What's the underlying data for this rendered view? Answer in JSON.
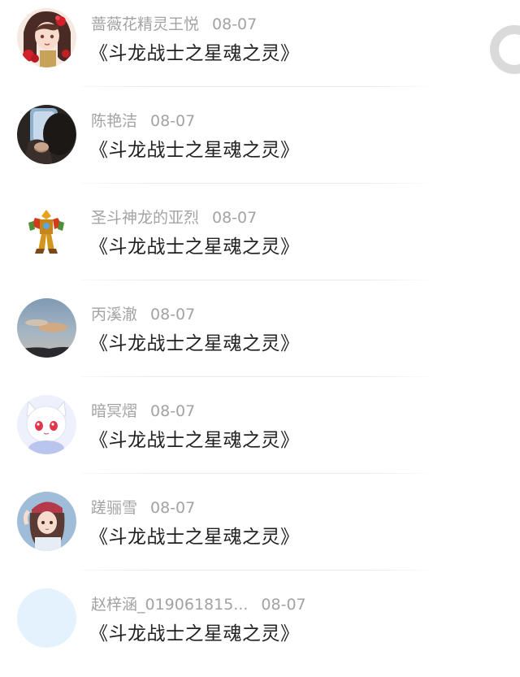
{
  "comments": [
    {
      "name": "蔷薇花精灵王悦",
      "date": "08-07",
      "text": "《斗龙战士之星魂之灵》",
      "avatar_icon": "anime-girl-red-flowers-avatar"
    },
    {
      "name": "陈艳洁",
      "date": "08-07",
      "text": "《斗龙战士之星魂之灵》",
      "avatar_icon": "person-photo-avatar"
    },
    {
      "name": "圣斗神龙的亚烈",
      "date": "08-07",
      "text": "《斗龙战士之星魂之灵》",
      "avatar_icon": "robot-mecha-avatar"
    },
    {
      "name": "丙溪澈",
      "date": "08-07",
      "text": "《斗龙战士之星魂之灵》",
      "avatar_icon": "dusk-sky-avatar"
    },
    {
      "name": "暗冥熠",
      "date": "08-07",
      "text": "《斗龙战士之星魂之灵》",
      "avatar_icon": "white-cat-girl-avatar"
    },
    {
      "name": "蹉骊雪",
      "date": "08-07",
      "text": "《斗龙战士之星魂之灵》",
      "avatar_icon": "anime-girl-cap-avatar"
    },
    {
      "name": "赵梓涵_019061815...",
      "date": "08-07",
      "text": "《斗龙战士之星魂之灵》",
      "avatar_icon": "blank-avatar"
    }
  ],
  "colors": {
    "name_text": "#a3a3a3",
    "title_text": "#222222",
    "divider": "#e9e9e9",
    "blank_avatar": "#e3f2fc"
  }
}
